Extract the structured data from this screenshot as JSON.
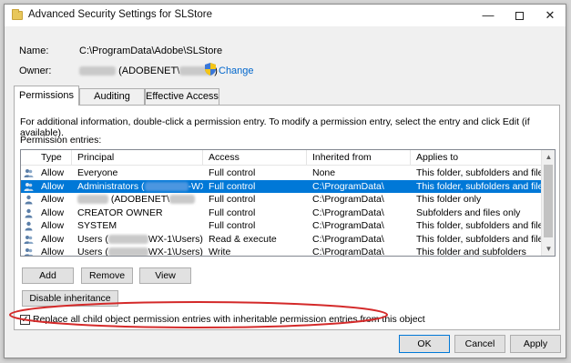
{
  "window": {
    "title": "Advanced Security Settings for SLStore"
  },
  "info": {
    "name_label": "Name:",
    "name_value": "C:\\ProgramData\\Adobe\\SLStore",
    "owner_label": "Owner:",
    "owner_value": "(ADOBENET\\",
    "change_link": "Change"
  },
  "tabs": [
    {
      "label": "Permissions",
      "active": true
    },
    {
      "label": "Auditing",
      "active": false
    },
    {
      "label": "Effective Access",
      "active": false
    }
  ],
  "permissions": {
    "info_text": "For additional information, double-click a permission entry. To modify a permission entry, select the entry and click Edit (if available).",
    "entries_label": "Permission entries:",
    "columns": [
      "Type",
      "Principal",
      "Access",
      "Inherited from",
      "Applies to"
    ],
    "rows": [
      {
        "type": "Allow",
        "principal": "Everyone",
        "access": "Full control",
        "inherited": "None",
        "applies": "This folder, subfolders and files",
        "selected": false
      },
      {
        "type": "Allow",
        "principal": "Administrators (",
        "principal_suffix": "-WX-...",
        "access": "Full control",
        "inherited": "C:\\ProgramData\\",
        "applies": "This folder, subfolders and files",
        "selected": true
      },
      {
        "type": "Allow",
        "principal": "(ADOBENET\\",
        "access": "Full control",
        "inherited": "C:\\ProgramData\\",
        "applies": "This folder only",
        "selected": false
      },
      {
        "type": "Allow",
        "principal": "CREATOR OWNER",
        "access": "Full control",
        "inherited": "C:\\ProgramData\\",
        "applies": "Subfolders and files only",
        "selected": false
      },
      {
        "type": "Allow",
        "principal": "SYSTEM",
        "access": "Full control",
        "inherited": "C:\\ProgramData\\",
        "applies": "This folder, subfolders and files",
        "selected": false
      },
      {
        "type": "Allow",
        "principal": "Users (",
        "principal_suffix": "WX-1\\Users)",
        "access": "Read & execute",
        "inherited": "C:\\ProgramData\\",
        "applies": "This folder, subfolders and files",
        "selected": false
      },
      {
        "type": "Allow",
        "principal": "Users (",
        "principal_suffix": "WX-1\\Users)",
        "access": "Write",
        "inherited": "C:\\ProgramData\\",
        "applies": "This folder and subfolders",
        "selected": false
      }
    ]
  },
  "buttons": {
    "add": "Add",
    "remove": "Remove",
    "view": "View",
    "disable_inheritance": "Disable inheritance",
    "ok": "OK",
    "cancel": "Cancel",
    "apply": "Apply"
  },
  "replace_checkbox": {
    "label": "Replace all child object permission entries with inheritable permission entries from this object",
    "checked": true
  },
  "colors": {
    "selection": "#0078d7",
    "link": "#0066cc",
    "annotation": "#d42a2a"
  }
}
